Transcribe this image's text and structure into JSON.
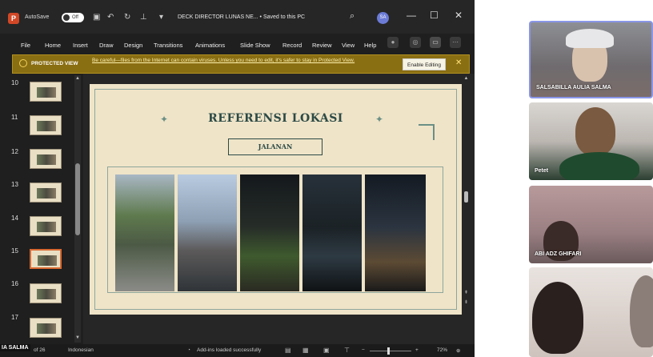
{
  "app": {
    "autosave_label": "AutoSave",
    "autosave_state": "Off",
    "document_title": "DECK DIRECTOR LUNAS NE... • Saved to this PC",
    "user_initials": "SA"
  },
  "menu": [
    "File",
    "Home",
    "Insert",
    "Draw",
    "Design",
    "Transitions",
    "Animations",
    "Slide Show",
    "Record",
    "Review",
    "View",
    "Help"
  ],
  "protected_view": {
    "title": "PROTECTED VIEW",
    "message": "Be careful—files from the Internet can contain viruses. Unless you need to edit, it's safer to stay in Protected View.",
    "enable_button": "Enable Editing"
  },
  "thumbnails": [
    {
      "num": "10",
      "selected": false
    },
    {
      "num": "11",
      "selected": false
    },
    {
      "num": "12",
      "selected": false
    },
    {
      "num": "13",
      "selected": false
    },
    {
      "num": "14",
      "selected": false
    },
    {
      "num": "15",
      "selected": true
    },
    {
      "num": "16",
      "selected": false
    },
    {
      "num": "17",
      "selected": false
    }
  ],
  "slide": {
    "title": "REFERENSI LOKASI",
    "subtitle": "JALANAN"
  },
  "status": {
    "slide_count": "of 26",
    "language": "Indonesian",
    "addins": "Add-ins loaded successfully",
    "zoom": "72%"
  },
  "screen_share_name": "IA SALMA",
  "participants": [
    {
      "name": "SALSABILLA AULIA SALMA",
      "active": true
    },
    {
      "name": "Petet",
      "active": false
    },
    {
      "name": "ABI ADZ GHIFARI",
      "active": false
    },
    {
      "name": "",
      "active": false
    }
  ],
  "colors": {
    "accent": "#d24726",
    "protected_bar": "#8a6e12",
    "slide_bg": "#efe4c8",
    "slide_text": "#2c4a46",
    "active_speaker": "#8a96e8"
  }
}
